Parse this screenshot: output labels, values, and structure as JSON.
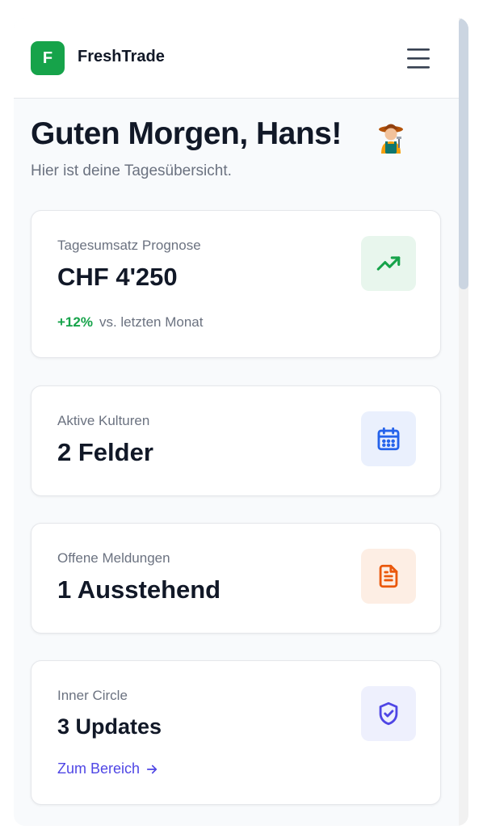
{
  "header": {
    "logo_letter": "F",
    "brand": "FreshTrade",
    "menu_icon": "hamburger-menu-icon"
  },
  "greeting": {
    "title": "Guten Morgen, Hans!",
    "emoji_icon": "farmer-emoji-icon",
    "subtitle": "Hier ist deine Tagesübersicht."
  },
  "cards": [
    {
      "label": "Tagesumsatz Prognose",
      "value": "CHF 4'250",
      "icon": "trending-up-icon",
      "icon_color": "#16a34a",
      "icon_bg": "#e8f6ed",
      "trend_value": "+12%",
      "trend_text": "vs. letzten Monat"
    },
    {
      "label": "Aktive Kulturen",
      "value": "2 Felder",
      "icon": "calendar-icon",
      "icon_color": "#2563eb",
      "icon_bg": "#eaf0fd"
    },
    {
      "label": "Offene Meldungen",
      "value": "1 Ausstehend",
      "icon": "document-icon",
      "icon_color": "#ea580c",
      "icon_bg": "#fdeee4"
    },
    {
      "label": "Inner Circle",
      "value": "3 Updates",
      "icon": "shield-check-icon",
      "icon_color": "#4f46e5",
      "icon_bg": "#eef0fd",
      "link_label": "Zum Bereich"
    }
  ],
  "colors": {
    "brand_green": "#16a34a",
    "accent_indigo": "#4f46e5",
    "text_dark": "#111827",
    "text_muted": "#6b7280"
  }
}
